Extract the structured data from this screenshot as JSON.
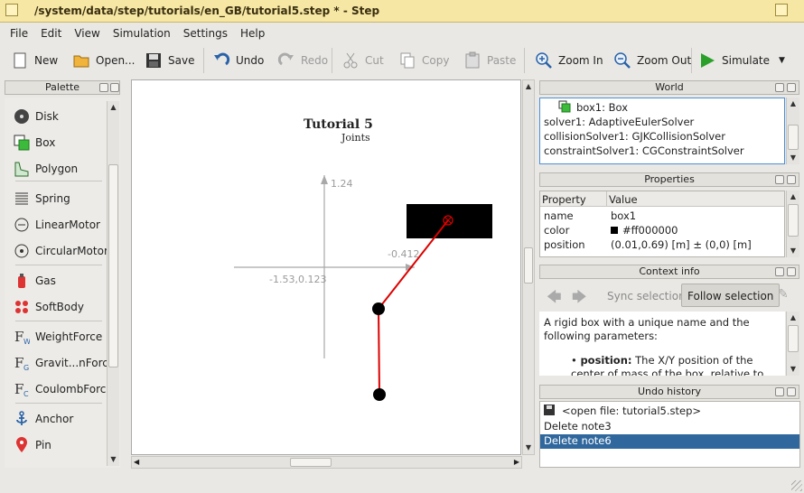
{
  "window": {
    "title": "/system/data/step/tutorials/en_GB/tutorial5.step * - Step"
  },
  "menu": [
    "File",
    "Edit",
    "View",
    "Simulation",
    "Settings",
    "Help"
  ],
  "toolbar": {
    "new": "New",
    "open": "Open...",
    "save": "Save",
    "undo": "Undo",
    "redo": "Redo",
    "cut": "Cut",
    "copy": "Copy",
    "paste": "Paste",
    "zoom_in": "Zoom In",
    "zoom_out": "Zoom Out",
    "simulate": "Simulate"
  },
  "palette": {
    "title": "Palette",
    "items": [
      "Disk",
      "Box",
      "Polygon",
      "Spring",
      "LinearMotor",
      "CircularMotor",
      "Gas",
      "SoftBody",
      "WeightForce",
      "Gravit...nForce",
      "CoulombForce",
      "Anchor",
      "Pin"
    ]
  },
  "canvas": {
    "title": "Tutorial 5",
    "subtitle": "Joints",
    "y_axis_label": "1.24",
    "x_axis_label": "-0.412",
    "origin_label": "-1.53,0.123"
  },
  "world": {
    "title": "World",
    "items": [
      "box1: Box",
      "solver1: AdaptiveEulerSolver",
      "collisionSolver1: GJKCollisionSolver",
      "constraintSolver1: CGConstraintSolver"
    ]
  },
  "properties": {
    "title": "Properties",
    "col_property": "Property",
    "col_value": "Value",
    "rows": [
      {
        "name": "name",
        "value": "box1"
      },
      {
        "name": "color",
        "value": "#ff000000"
      },
      {
        "name": "position",
        "value": "(0.01,0.69) [m] ± (0,0) [m]"
      }
    ]
  },
  "context": {
    "title": "Context info",
    "sync": "Sync selection",
    "follow": "Follow selection",
    "text1": "A rigid box with a unique name and the following parameters:",
    "bullet_term": "position:",
    "bullet_text": "The X/Y position of the center of mass of the box, relative to the center of the"
  },
  "undo": {
    "title": "Undo history",
    "items": [
      "<open file: tutorial5.step>",
      "Delete note3",
      "Delete note6"
    ]
  },
  "colors": {
    "titlebar": "#f6e7a5",
    "selection": "#30689e",
    "link_red": "#dd0000"
  }
}
